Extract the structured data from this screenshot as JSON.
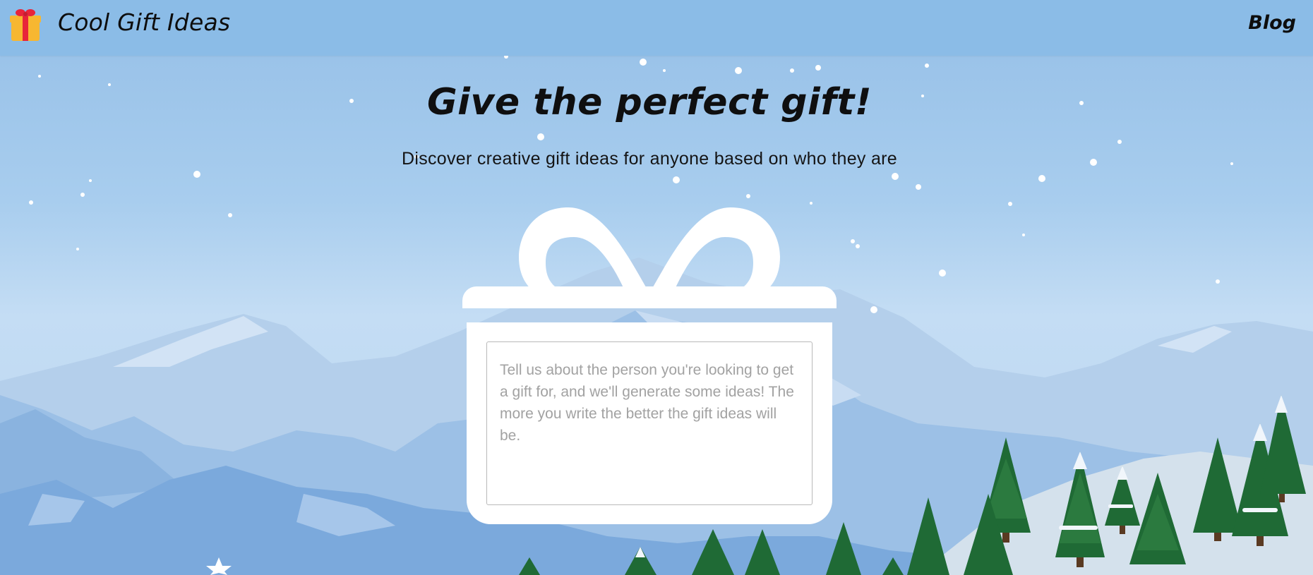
{
  "header": {
    "brand": "Cool Gift Ideas",
    "nav_blog": "Blog"
  },
  "hero": {
    "title": "Give the perfect gift!",
    "subtitle": "Discover creative gift ideas for anyone based on who they are"
  },
  "form": {
    "placeholder": "Tell us about the person you're looking to get a gift for, and we'll generate some ideas! The more you write the better the gift ideas will be.",
    "value": ""
  },
  "icons": {
    "logo": "gift-icon",
    "hero_graphic": "gift-box-illustration"
  },
  "colors": {
    "header_bg": "#8bbce7",
    "gift_ribbon": "#e8243a",
    "gift_box": "#f7b731",
    "tree_green": "#1f6a35"
  }
}
